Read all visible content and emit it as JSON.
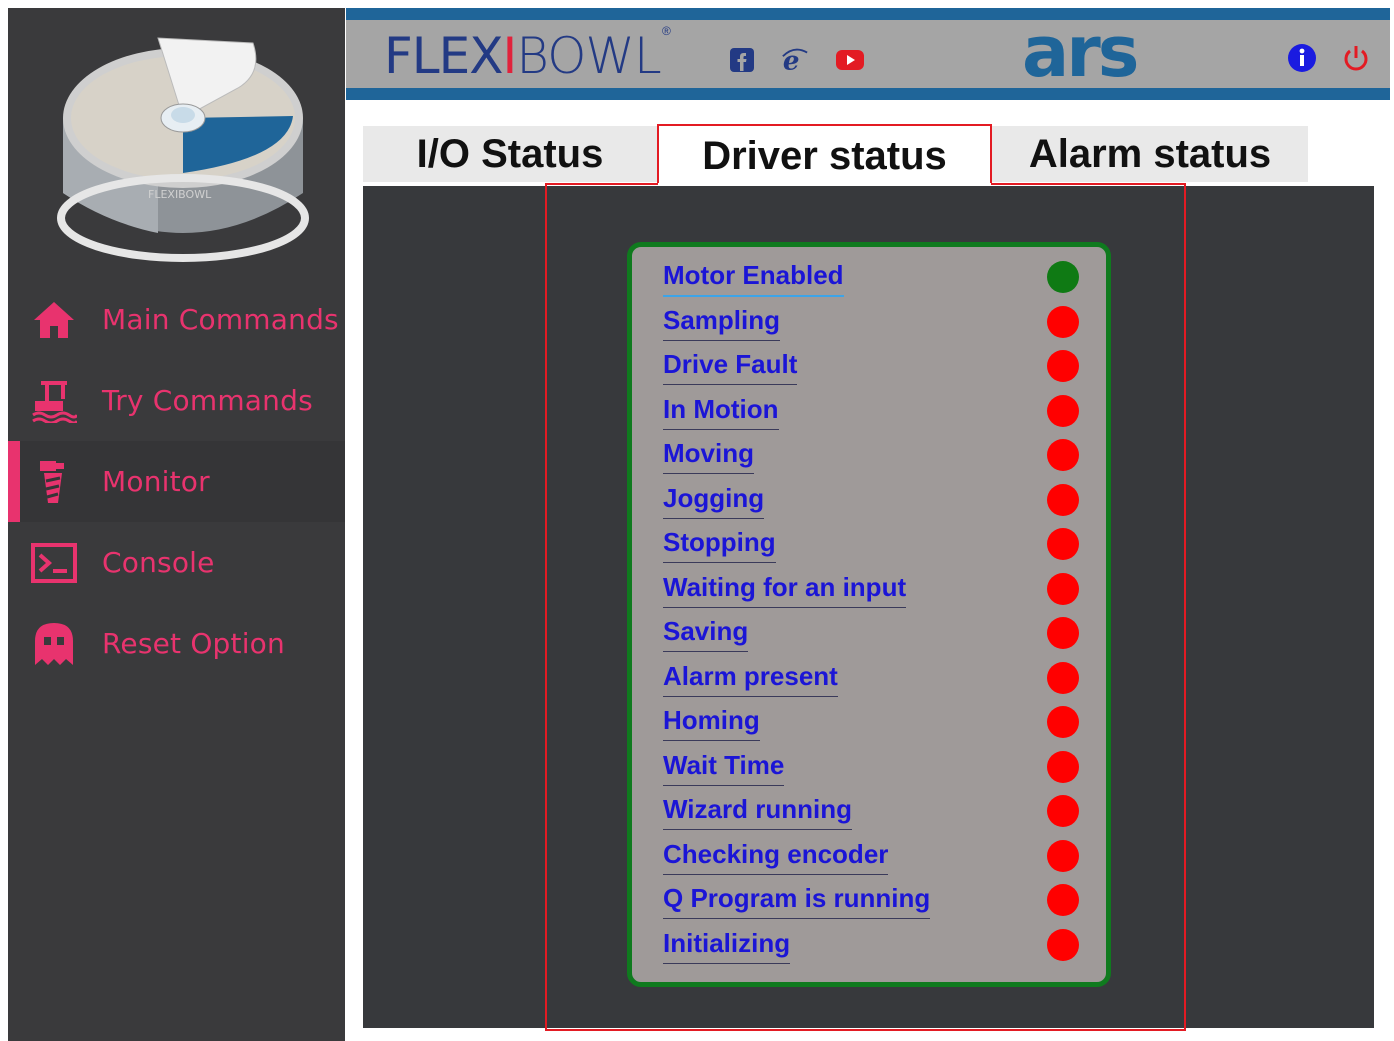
{
  "sidebar": {
    "items": [
      {
        "label": "Main Commands",
        "icon": "home-icon",
        "active": false
      },
      {
        "label": "Try Commands",
        "icon": "robot-arm-icon",
        "active": false
      },
      {
        "label": "Monitor",
        "icon": "monitor-tool-icon",
        "active": true
      },
      {
        "label": "Console",
        "icon": "terminal-icon",
        "active": false
      },
      {
        "label": "Reset Option",
        "icon": "ghost-icon",
        "active": false
      }
    ]
  },
  "header": {
    "brand_prefix": "FLEX",
    "brand_accent": "I",
    "brand_suffix": "BOWL",
    "brand_reg": "®",
    "company": "ars",
    "social": [
      "facebook-icon",
      "internet-explorer-icon",
      "youtube-icon"
    ],
    "actions": [
      "info-icon",
      "power-icon"
    ]
  },
  "tabs": [
    {
      "label": "I/O Status",
      "active": false
    },
    {
      "label": "Driver status",
      "active": true
    },
    {
      "label": "Alarm status",
      "active": false
    }
  ],
  "driver_status": [
    {
      "label": "Motor Enabled",
      "state": "on"
    },
    {
      "label": "Sampling",
      "state": "off"
    },
    {
      "label": "Drive Fault",
      "state": "off"
    },
    {
      "label": "In Motion",
      "state": "off"
    },
    {
      "label": "Moving",
      "state": "off"
    },
    {
      "label": "Jogging",
      "state": "off"
    },
    {
      "label": "Stopping",
      "state": "off"
    },
    {
      "label": "Waiting for an input",
      "state": "off"
    },
    {
      "label": "Saving",
      "state": "off"
    },
    {
      "label": "Alarm present",
      "state": "off"
    },
    {
      "label": "Homing",
      "state": "off"
    },
    {
      "label": "Wait Time",
      "state": "off"
    },
    {
      "label": "Wizard running",
      "state": "off"
    },
    {
      "label": "Checking encoder",
      "state": "off"
    },
    {
      "label": "Q Program is running",
      "state": "off"
    },
    {
      "label": "Initializing",
      "state": "off"
    }
  ],
  "colors": {
    "accent": "#e8336e",
    "brand_blue": "#1f6599",
    "led_on": "#0f7a14",
    "led_off": "#ff0000",
    "status_text": "#1b15d6"
  }
}
